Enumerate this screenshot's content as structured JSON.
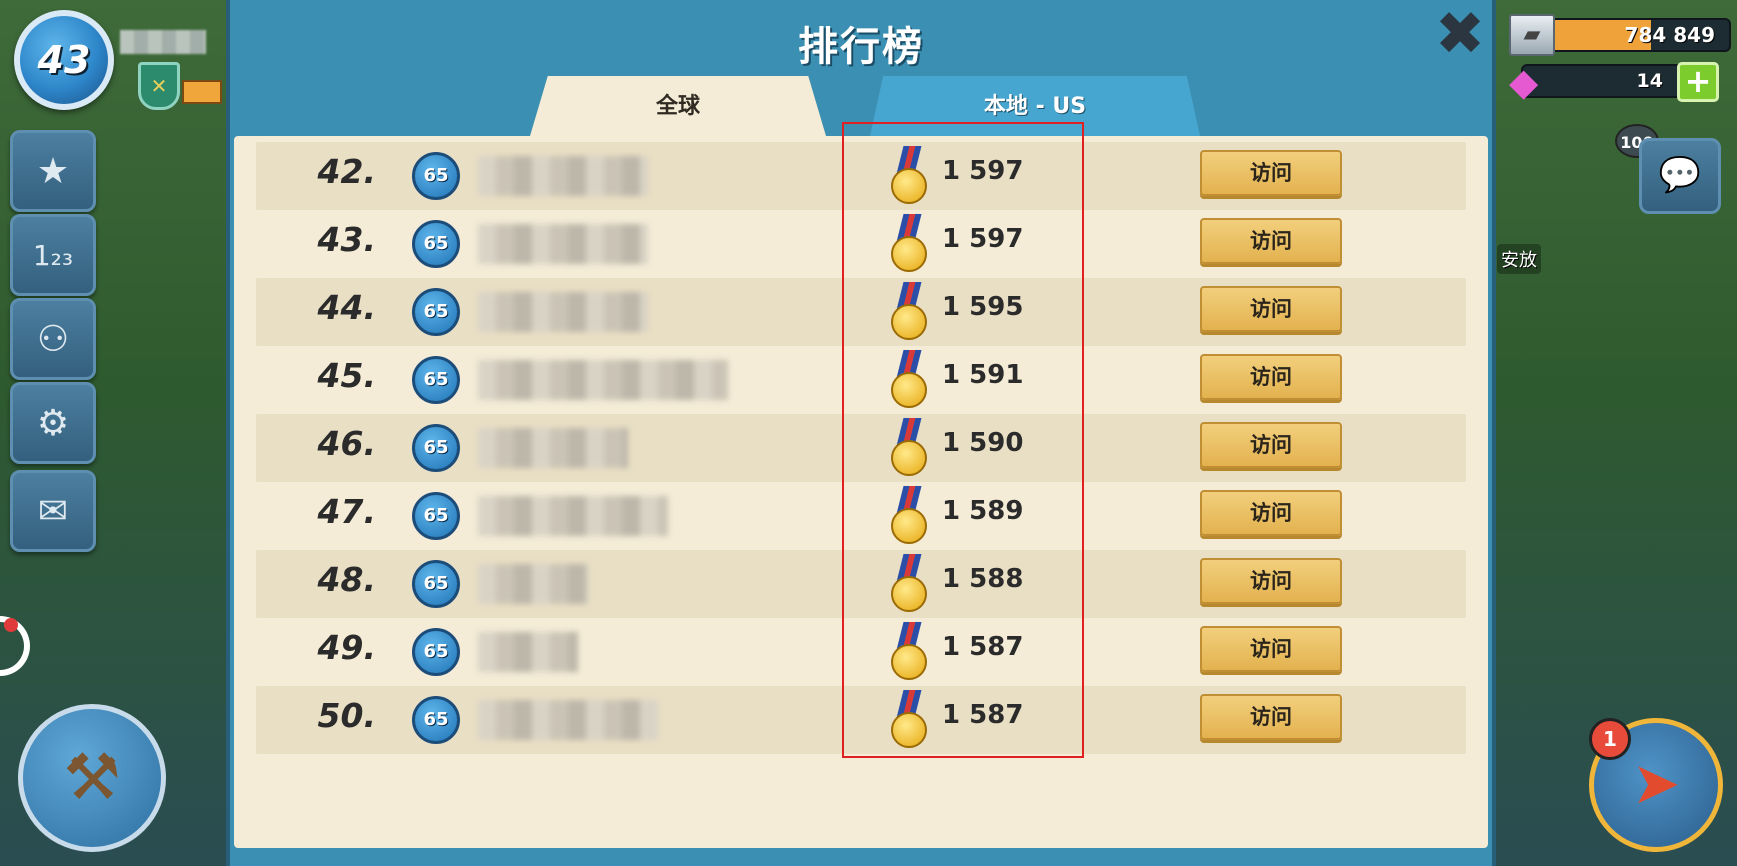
{
  "hud_left": {
    "level": "43",
    "buttons": [
      "star-icon",
      "leaderboard-icon",
      "social-icon",
      "gear-icon",
      "mail-icon"
    ]
  },
  "hud_right": {
    "iron_value": "784 849",
    "gems_value": "14",
    "chat_count": "100",
    "map_label": "安放",
    "compass_count": "1"
  },
  "leaderboard": {
    "title": "排行榜",
    "tabs": {
      "global": "全球",
      "local": "本地 - US"
    },
    "visit_label": "访问",
    "rows": [
      {
        "rank": "42.",
        "level": "65",
        "score": "1 597"
      },
      {
        "rank": "43.",
        "level": "65",
        "score": "1 597"
      },
      {
        "rank": "44.",
        "level": "65",
        "score": "1 595"
      },
      {
        "rank": "45.",
        "level": "65",
        "score": "1 591"
      },
      {
        "rank": "46.",
        "level": "65",
        "score": "1 590"
      },
      {
        "rank": "47.",
        "level": "65",
        "score": "1 589"
      },
      {
        "rank": "48.",
        "level": "65",
        "score": "1 588"
      },
      {
        "rank": "49.",
        "level": "65",
        "score": "1 587"
      },
      {
        "rank": "50.",
        "level": "65",
        "score": "1 587"
      }
    ]
  },
  "colors": {
    "panel": "#3b8fb2",
    "board": "#f4ecd6",
    "highlight": "#e02020",
    "visit_button": "#e3b24f"
  }
}
